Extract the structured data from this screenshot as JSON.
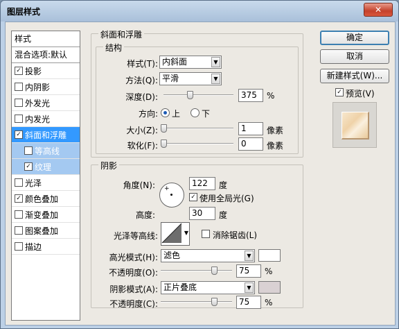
{
  "window": {
    "title": "图层样式",
    "close_label": "✕"
  },
  "left_panel": {
    "header": "样式",
    "blend_options": "混合选项:默认",
    "items": [
      {
        "label": "投影",
        "checked": true
      },
      {
        "label": "内阴影",
        "checked": false
      },
      {
        "label": "外发光",
        "checked": false
      },
      {
        "label": "内发光",
        "checked": false
      },
      {
        "label": "斜面和浮雕",
        "checked": true,
        "selected": true
      },
      {
        "label": "等高线",
        "checked": false,
        "sub": true
      },
      {
        "label": "纹理",
        "checked": true,
        "sub": true
      },
      {
        "label": "光泽",
        "checked": false
      },
      {
        "label": "颜色叠加",
        "checked": true
      },
      {
        "label": "渐变叠加",
        "checked": false
      },
      {
        "label": "图案叠加",
        "checked": false
      },
      {
        "label": "描边",
        "checked": false
      }
    ]
  },
  "bevel": {
    "section_title": "斜面和浮雕",
    "structure_title": "结构",
    "style_label": "样式(T):",
    "style_value": "内斜面",
    "technique_label": "方法(Q):",
    "technique_value": "平滑",
    "depth_label": "深度(D):",
    "depth_value": "375",
    "depth_unit": "%",
    "depth_slider": 0.38,
    "direction_label": "方向:",
    "direction_up": "上",
    "direction_down": "下",
    "direction_selected": "上",
    "size_label": "大小(Z):",
    "size_value": "1",
    "size_unit": "像素",
    "size_slider": 0.0,
    "soften_label": "软化(F):",
    "soften_value": "0",
    "soften_unit": "像素",
    "soften_slider": 0.0
  },
  "shading": {
    "title": "阴影",
    "angle_label": "角度(N):",
    "angle_value": "122",
    "angle_unit": "度",
    "use_global_light": "使用全局光(G)",
    "use_global_light_checked": true,
    "altitude_label": "高度:",
    "altitude_value": "30",
    "altitude_unit": "度",
    "gloss_contour_label": "光泽等高线:",
    "anti_aliased": "消除锯齿(L)",
    "anti_aliased_checked": false,
    "highlight_mode_label": "高光模式(H):",
    "highlight_mode_value": "滤色",
    "highlight_color": "#ffffff",
    "highlight_opacity_label": "不透明度(O):",
    "highlight_opacity_value": "75",
    "highlight_opacity_unit": "%",
    "highlight_opacity_slider": 0.75,
    "shadow_mode_label": "阴影模式(A):",
    "shadow_mode_value": "正片叠底",
    "shadow_color": "#d9d1d3",
    "shadow_opacity_label": "不透明度(C):",
    "shadow_opacity_value": "75",
    "shadow_opacity_unit": "%",
    "shadow_opacity_slider": 0.75
  },
  "buttons": {
    "ok": "确定",
    "cancel": "取消",
    "new_style": "新建样式(W)...",
    "preview": "预览(V)",
    "preview_checked": true
  },
  "colors": {
    "selection": "#3399ff",
    "title_bar": "#bcd0e6"
  }
}
